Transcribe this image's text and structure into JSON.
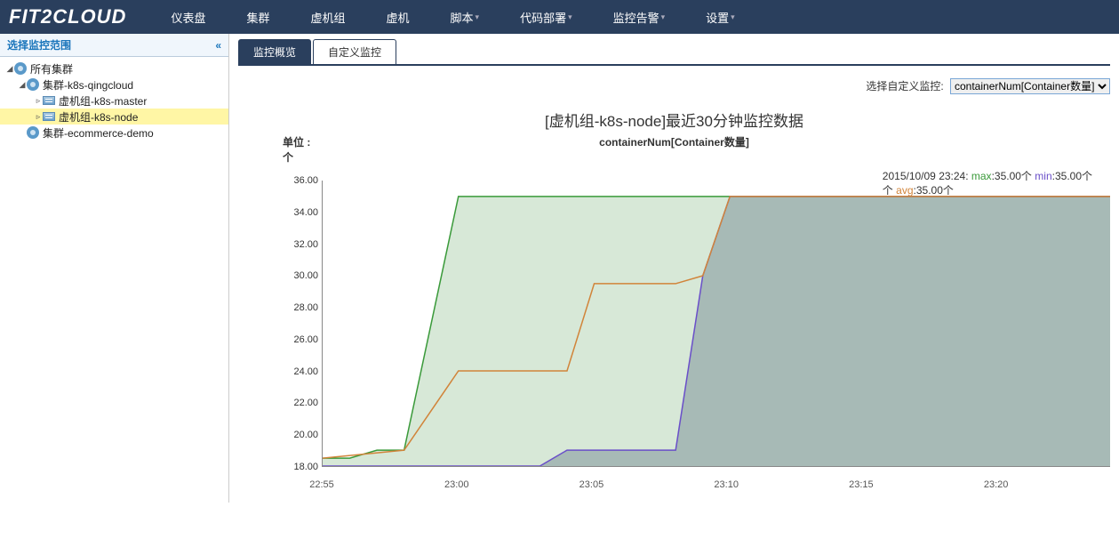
{
  "brand": "FIT2CLOUD",
  "nav": [
    "仪表盘",
    "集群",
    "虚机组",
    "虚机",
    "脚本",
    "代码部署",
    "监控告警",
    "设置"
  ],
  "nav_has_dropdown": [
    false,
    false,
    false,
    false,
    true,
    true,
    true,
    true
  ],
  "sidebar": {
    "title": "选择监控范围",
    "nodes": {
      "root": "所有集群",
      "c1": "集群-k8s-qingcloud",
      "g1": "虚机组-k8s-master",
      "g2": "虚机组-k8s-node",
      "c2": "集群-ecommerce-demo"
    }
  },
  "tabs": {
    "overview": "监控概览",
    "custom": "自定义监控"
  },
  "selector": {
    "label": "选择自定义监控:",
    "value": "containerNum[Container数量]"
  },
  "chart": {
    "title": "[虚机组-k8s-node]最近30分钟监控数据",
    "unit_label": "单位 : 个",
    "series_label": "containerNum[Container数量]"
  },
  "legend": {
    "time": "2015/10/09 23:24",
    "max_label": "max",
    "max_val": "35.00个",
    "min_label": "min",
    "min_val": "35.00个",
    "avg_label": "avg",
    "avg_val": "35.00个"
  },
  "chart_data": {
    "type": "area",
    "xlabel": "",
    "ylabel": "个",
    "x_ticks": [
      "22:55",
      "23:00",
      "23:05",
      "23:10",
      "23:15",
      "23:20"
    ],
    "y_ticks": [
      18,
      20,
      22,
      24,
      26,
      28,
      30,
      32,
      34,
      36
    ],
    "ylim": [
      18,
      36
    ],
    "series": [
      {
        "name": "max",
        "color": "#3a9a3a",
        "x": [
          0,
          1,
          2,
          3,
          5,
          6,
          7,
          29
        ],
        "values": [
          18.5,
          18.5,
          19,
          19,
          35,
          35,
          35,
          35
        ]
      },
      {
        "name": "min",
        "color": "#6a4fc9",
        "x": [
          0,
          1,
          3,
          6,
          8,
          9,
          10,
          12,
          13,
          14,
          15,
          16,
          29
        ],
        "values": [
          18,
          18,
          18,
          18,
          18,
          19,
          19,
          19,
          19,
          30,
          35,
          35,
          35
        ]
      },
      {
        "name": "avg",
        "color": "#d1843a",
        "x": [
          0,
          3,
          5,
          6,
          8,
          9,
          10,
          12,
          13,
          14,
          15,
          29
        ],
        "values": [
          18.5,
          19,
          24,
          24,
          24,
          24,
          29.5,
          29.5,
          29.5,
          30,
          35,
          35
        ]
      }
    ],
    "x_range": [
      0,
      29
    ]
  }
}
